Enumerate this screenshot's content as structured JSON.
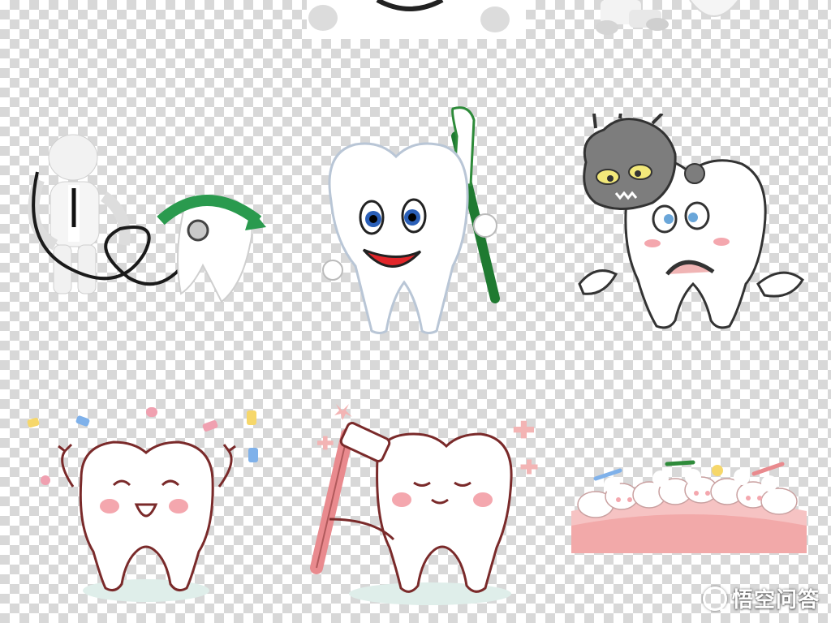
{
  "watermark": {
    "text": "悟空问答"
  },
  "background": {
    "pattern": "transparency-checkerboard",
    "colors": [
      "#ffffff",
      "#d8d8d8"
    ]
  },
  "illustrations": [
    {
      "id": "top-white-figure-sign",
      "row": 0,
      "col": 1
    },
    {
      "id": "top-white-figure-standing",
      "row": 0,
      "col": 2
    },
    {
      "id": "doctor-figure-with-stethoscope-and-tooth",
      "row": 1,
      "col": 0
    },
    {
      "id": "smiling-tooth-with-toothbrush",
      "row": 1,
      "col": 1
    },
    {
      "id": "worried-tooth-with-germ",
      "row": 1,
      "col": 2
    },
    {
      "id": "happy-tooth-with-confetti",
      "row": 2,
      "col": 0
    },
    {
      "id": "tooth-brushing-itself",
      "row": 2,
      "col": 1
    },
    {
      "id": "teeth-on-gum-with-foam",
      "row": 2,
      "col": 2
    }
  ],
  "colors": {
    "tooth_outline_pink": "#7a2a2a",
    "blush": "#f4a7ae",
    "toothbrush_green": "#2e8b3a",
    "toothbrush_pink": "#e98a8e",
    "gum_pink": "#f6c3c3",
    "germ_gray": "#7d7d7d",
    "eye_blue": "#2a5fb8"
  }
}
